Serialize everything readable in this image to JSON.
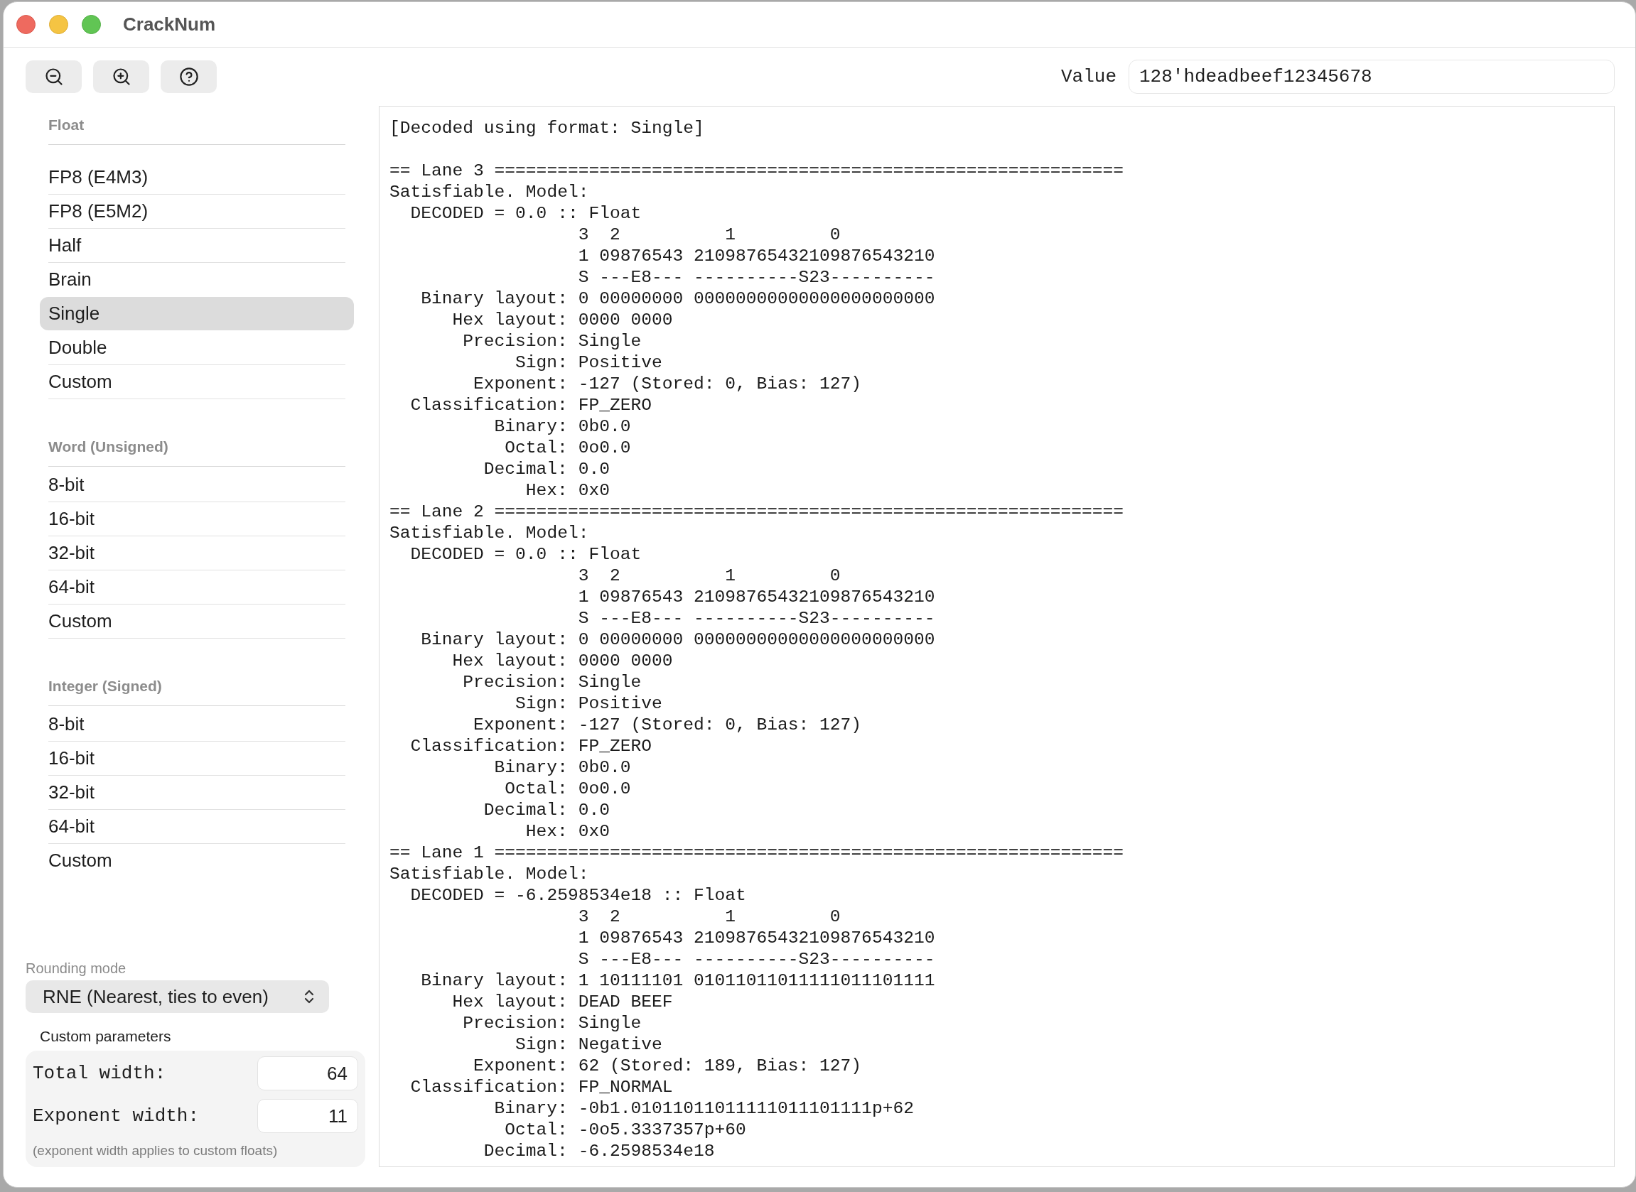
{
  "window": {
    "title": "CrackNum"
  },
  "toolbar": [
    {
      "kind": "zoom_out"
    },
    {
      "kind": "zoom_in"
    },
    {
      "kind": "help"
    }
  ],
  "value_field": {
    "label": "Value",
    "value": "128'hdeadbeef12345678"
  },
  "sidebar": {
    "sections": [
      {
        "title": "Float",
        "items": [
          {
            "label": "FP8 (E4M3)",
            "selected": false
          },
          {
            "label": "FP8 (E5M2)",
            "selected": false
          },
          {
            "label": "Half",
            "selected": false
          },
          {
            "label": "Brain",
            "selected": false
          },
          {
            "label": "Single",
            "selected": true
          },
          {
            "label": "Double",
            "selected": false
          },
          {
            "label": "Custom",
            "selected": false
          }
        ]
      },
      {
        "title": "Word (Unsigned)",
        "items": [
          {
            "label": "8-bit",
            "selected": false
          },
          {
            "label": "16-bit",
            "selected": false
          },
          {
            "label": "32-bit",
            "selected": false
          },
          {
            "label": "64-bit",
            "selected": false
          },
          {
            "label": "Custom",
            "selected": false
          }
        ]
      },
      {
        "title": "Integer (Signed)",
        "items": [
          {
            "label": "8-bit",
            "selected": false
          },
          {
            "label": "16-bit",
            "selected": false
          },
          {
            "label": "32-bit",
            "selected": false
          },
          {
            "label": "64-bit",
            "selected": false
          },
          {
            "label": "Custom",
            "selected": false
          }
        ]
      }
    ]
  },
  "rounding_mode": {
    "label": "Rounding mode",
    "value": "RNE (Nearest, ties to even)"
  },
  "custom_parameters": {
    "title": "Custom parameters",
    "fields": [
      {
        "label": "Total width:",
        "value": "64"
      },
      {
        "label": "Exponent width:",
        "value": "11"
      }
    ],
    "note": "(exponent width applies to custom floats)"
  },
  "output": {
    "header": "[Decoded using format: Single]",
    "lanes": [
      {
        "title": "== Lane 3 ============================================================",
        "status": "Satisfiable. Model:",
        "decoded": "DECODED = 0.0 :: Float",
        "bit_ruler": [
          "3  2          1         0",
          "1 09876543 21098765432109876543210",
          "S ---E8--- ----------S23----------"
        ],
        "fields": [
          {
            "label": "Binary layout:",
            "value": "0 00000000 00000000000000000000000"
          },
          {
            "label": "Hex layout:",
            "value": "0000 0000"
          },
          {
            "label": "Precision:",
            "value": "Single"
          },
          {
            "label": "Sign:",
            "value": "Positive"
          },
          {
            "label": "Exponent:",
            "value": "-127 (Stored: 0, Bias: 127)"
          },
          {
            "label": "Classification:",
            "value": "FP_ZERO"
          },
          {
            "label": "Binary:",
            "value": "0b0.0"
          },
          {
            "label": "Octal:",
            "value": "0o0.0"
          },
          {
            "label": "Decimal:",
            "value": "0.0"
          },
          {
            "label": "Hex:",
            "value": "0x0"
          }
        ]
      },
      {
        "title": "== Lane 2 ============================================================",
        "status": "Satisfiable. Model:",
        "decoded": "DECODED = 0.0 :: Float",
        "bit_ruler": [
          "3  2          1         0",
          "1 09876543 21098765432109876543210",
          "S ---E8--- ----------S23----------"
        ],
        "fields": [
          {
            "label": "Binary layout:",
            "value": "0 00000000 00000000000000000000000"
          },
          {
            "label": "Hex layout:",
            "value": "0000 0000"
          },
          {
            "label": "Precision:",
            "value": "Single"
          },
          {
            "label": "Sign:",
            "value": "Positive"
          },
          {
            "label": "Exponent:",
            "value": "-127 (Stored: 0, Bias: 127)"
          },
          {
            "label": "Classification:",
            "value": "FP_ZERO"
          },
          {
            "label": "Binary:",
            "value": "0b0.0"
          },
          {
            "label": "Octal:",
            "value": "0o0.0"
          },
          {
            "label": "Decimal:",
            "value": "0.0"
          },
          {
            "label": "Hex:",
            "value": "0x0"
          }
        ]
      },
      {
        "title": "== Lane 1 ============================================================",
        "status": "Satisfiable. Model:",
        "decoded": "DECODED = -6.2598534e18 :: Float",
        "bit_ruler": [
          "3  2          1         0",
          "1 09876543 21098765432109876543210",
          "S ---E8--- ----------S23----------"
        ],
        "fields": [
          {
            "label": "Binary layout:",
            "value": "1 10111101 01011011011111011101111"
          },
          {
            "label": "Hex layout:",
            "value": "DEAD BEEF"
          },
          {
            "label": "Precision:",
            "value": "Single"
          },
          {
            "label": "Sign:",
            "value": "Negative"
          },
          {
            "label": "Exponent:",
            "value": "62 (Stored: 189, Bias: 127)"
          },
          {
            "label": "Classification:",
            "value": "FP_NORMAL"
          },
          {
            "label": "Binary:",
            "value": "-0b1.01011011011111011101111p+62"
          },
          {
            "label": "Octal:",
            "value": "-0o5.3337357p+60"
          },
          {
            "label": "Decimal:",
            "value": "-6.2598534e18"
          }
        ]
      }
    ]
  }
}
